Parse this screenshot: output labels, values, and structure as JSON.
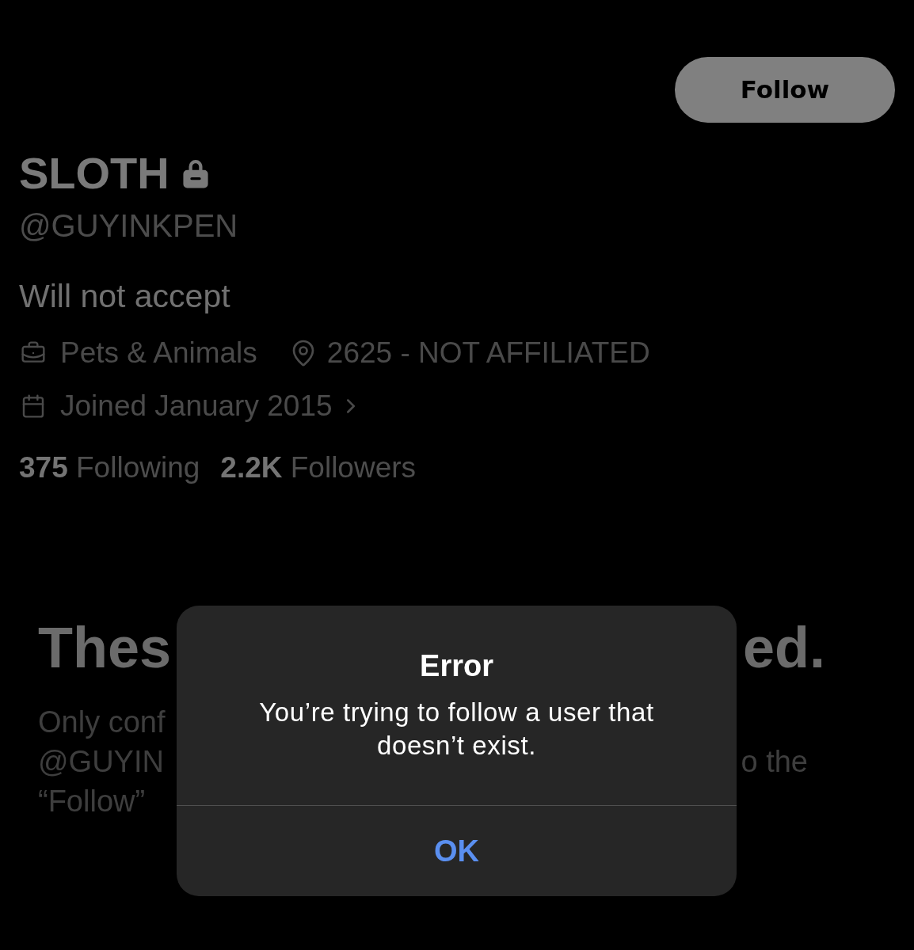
{
  "profile": {
    "follow_button": "Follow",
    "name": "SLOTH",
    "protected": true,
    "handle": "@GUYINKPEN",
    "bio": "Will not accept",
    "meta": [
      {
        "kind": "category",
        "text": "Pets & Animals"
      },
      {
        "kind": "location",
        "text": "2625 - NOT AFFILIATED"
      }
    ],
    "joined": "Joined January 2015",
    "stats": [
      {
        "count": "375",
        "label": "Following"
      },
      {
        "count": "2.2K",
        "label": "Followers"
      }
    ]
  },
  "protected_notice": {
    "heading_left": "Thes",
    "heading_right": "ed.",
    "body_lines": [
      {
        "left": "Only conf"
      },
      {
        "left": "@GUYIN",
        "right": "o the"
      },
      {
        "left": "“Follow”"
      }
    ]
  },
  "alert": {
    "title": "Error",
    "message": "You’re trying to follow a user that doesn’t exist.",
    "buttons": [
      "OK"
    ]
  }
}
